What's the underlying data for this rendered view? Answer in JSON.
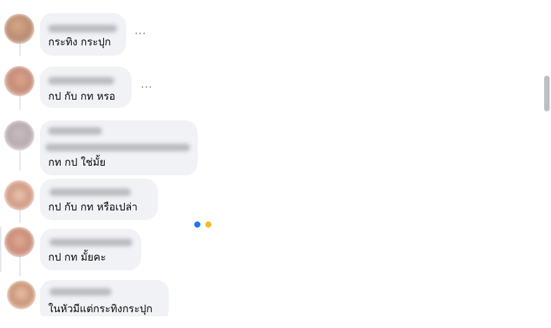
{
  "colors": {
    "bubble": "#f0f2f5",
    "text": "#050505",
    "muted": "#65676b",
    "scrollbar": "#bcc0c4",
    "reaction_blue": "#1877f2",
    "reaction_yellow": "#f7b928"
  },
  "more_glyph": "···",
  "comments": [
    {
      "text": "กระทิง กระปุก"
    },
    {
      "text": "กป กับ กท หรอ"
    },
    {
      "text": "กท กป ใช่มั้ย"
    },
    {
      "text": "กป กับ กท หรือเปล่า"
    },
    {
      "text": "กป กท มั้ยคะ"
    },
    {
      "text": "ในหัวมีแต่กระทิงกระปุก"
    }
  ]
}
